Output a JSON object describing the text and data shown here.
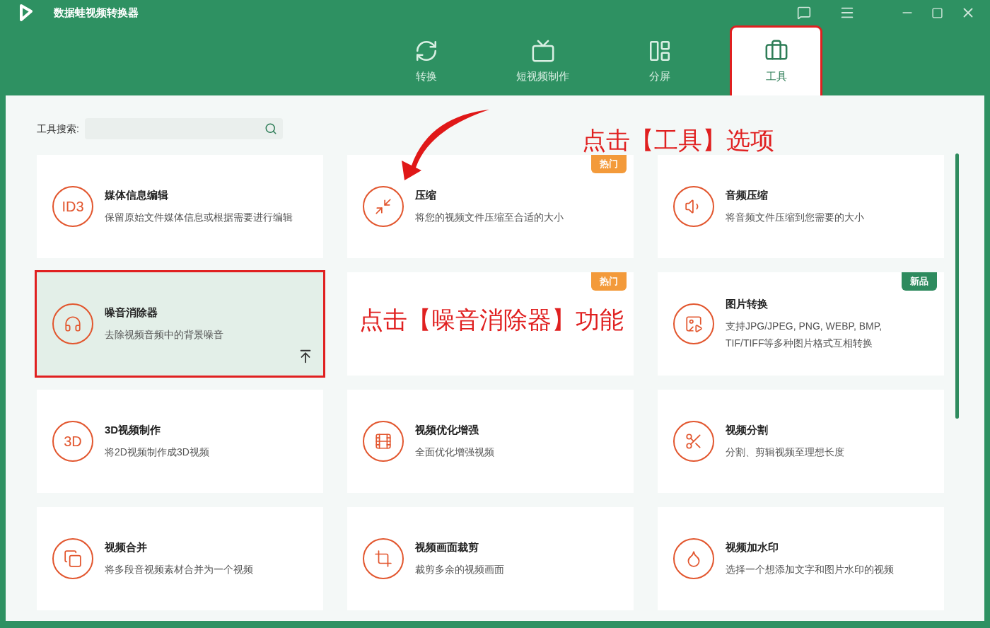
{
  "window": {
    "title": "数据蛙视频转换器"
  },
  "tabs": [
    {
      "label": "转换",
      "kind": "convert",
      "selected": false,
      "highlighted": false
    },
    {
      "label": "短视频制作",
      "kind": "tv",
      "selected": false,
      "highlighted": false
    },
    {
      "label": "分屏",
      "kind": "split",
      "selected": false,
      "highlighted": false
    },
    {
      "label": "工具",
      "kind": "toolbox",
      "selected": true,
      "highlighted": true
    }
  ],
  "search": {
    "label": "工具搜索:"
  },
  "tools": [
    {
      "title": "媒体信息编辑",
      "description": "保留原始文件媒体信息或根据需要进行编辑",
      "kind": "text",
      "icon_text": "ID3",
      "selected": false,
      "highlighted": false
    },
    {
      "title": "压缩",
      "description": "将您的视频文件压缩至合适的大小",
      "kind": "compress",
      "badge": {
        "text": "热门",
        "kind": "hot"
      },
      "selected": false,
      "highlighted": false
    },
    {
      "title": "音频压缩",
      "description": "将音频文件压缩到您需要的大小",
      "kind": "audio",
      "selected": false,
      "highlighted": false
    },
    {
      "title": "噪音消除器",
      "description": "去除视频音频中的背景噪音",
      "kind": "headphones",
      "selected": true,
      "highlighted": true
    },
    {
      "badge": {
        "text": "热门",
        "kind": "hot"
      },
      "selected": false,
      "highlighted": false
    },
    {
      "title": "图片转换",
      "description": "支持JPG/JPEG, PNG, WEBP, BMP, TIF/TIFF等多种图片格式互相转换",
      "kind": "image",
      "badge": {
        "text": "新品",
        "kind": "new"
      },
      "selected": false,
      "highlighted": false
    },
    {
      "title": "3D视频制作",
      "description": "将2D视频制作成3D视频",
      "kind": "text",
      "icon_text": "3D",
      "selected": false,
      "highlighted": false
    },
    {
      "title": "视频优化增强",
      "description": "全面优化增强视频",
      "kind": "enhance",
      "selected": false,
      "highlighted": false
    },
    {
      "title": "视频分割",
      "description": "分割、剪辑视频至理想长度",
      "kind": "scissors",
      "selected": false,
      "highlighted": false
    },
    {
      "title": "视频合并",
      "description": "将多段音视频素材合并为一个视频",
      "kind": "merge",
      "selected": false,
      "highlighted": false
    },
    {
      "title": "视频画面裁剪",
      "description": "裁剪多余的视频画面",
      "kind": "crop",
      "selected": false,
      "highlighted": false
    },
    {
      "title": "视频加水印",
      "description": "选择一个想添加文字和图片水印的视频",
      "kind": "drop",
      "selected": false,
      "highlighted": false
    }
  ],
  "annotations": [
    {
      "text": "点击【工具】选项"
    },
    {
      "text": "点击【噪音消除器】功能"
    }
  ]
}
